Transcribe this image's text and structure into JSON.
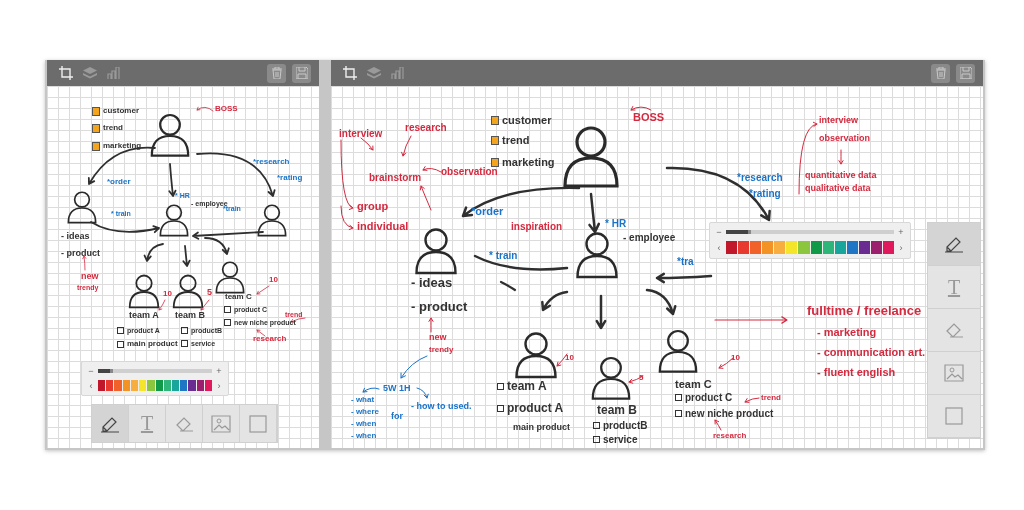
{
  "panels": [
    {
      "notes": [
        {
          "text": "customer",
          "color": "#333333",
          "kind": "tag"
        },
        {
          "text": "trend",
          "color": "#333333",
          "kind": "tag"
        },
        {
          "text": "marketing",
          "color": "#333333",
          "kind": "tag"
        },
        {
          "text": "BOSS",
          "color": "#d42a3f",
          "kind": "plain"
        },
        {
          "text": "*order",
          "color": "#1a73c8",
          "kind": "plain"
        },
        {
          "text": "*research",
          "color": "#1a73c8",
          "kind": "plain"
        },
        {
          "text": "*rating",
          "color": "#1a73c8",
          "kind": "plain"
        },
        {
          "text": "* HR",
          "color": "#1a73c8",
          "kind": "plain"
        },
        {
          "text": "- employee",
          "color": "#333333",
          "kind": "plain"
        },
        {
          "text": "* train",
          "color": "#1a73c8",
          "kind": "plain"
        },
        {
          "text": "*train",
          "color": "#1a73c8",
          "kind": "plain"
        },
        {
          "text": "- ideas",
          "color": "#333333",
          "kind": "plain"
        },
        {
          "text": "- product",
          "color": "#333333",
          "kind": "plain"
        },
        {
          "text": "new",
          "color": "#d42a3f",
          "kind": "plain"
        },
        {
          "text": "trendy",
          "color": "#d42a3f",
          "kind": "plain"
        },
        {
          "text": "10",
          "color": "#d42a3f",
          "kind": "plain"
        },
        {
          "text": "5",
          "color": "#d42a3f",
          "kind": "plain"
        },
        {
          "text": "10",
          "color": "#d42a3f",
          "kind": "plain"
        },
        {
          "text": "team A",
          "color": "#333333",
          "kind": "plain"
        },
        {
          "text": "team B",
          "color": "#333333",
          "kind": "plain"
        },
        {
          "text": "team C",
          "color": "#333333",
          "kind": "plain"
        },
        {
          "text": "product A",
          "color": "#333333",
          "kind": "checkbox"
        },
        {
          "text": "main product",
          "color": "#333333",
          "kind": "checkbox"
        },
        {
          "text": "productB",
          "color": "#333333",
          "kind": "checkbox"
        },
        {
          "text": "service",
          "color": "#333333",
          "kind": "checkbox"
        },
        {
          "text": "product C",
          "color": "#333333",
          "kind": "checkbox"
        },
        {
          "text": "new niche product",
          "color": "#333333",
          "kind": "checkbox"
        },
        {
          "text": "trend",
          "color": "#d42a3f",
          "kind": "plain"
        },
        {
          "text": "research",
          "color": "#d42a3f",
          "kind": "plain"
        }
      ],
      "palette": {
        "minus": "−",
        "plus": "+",
        "prev": "‹",
        "next": "›",
        "level": 0.13,
        "swatches": [
          {
            "color": "#c0182a"
          },
          {
            "color": "#e8392f"
          },
          {
            "color": "#f0622a"
          },
          {
            "color": "#f39325"
          },
          {
            "color": "#f8ae3f"
          },
          {
            "color": "#f5e52a"
          },
          {
            "color": "#8cc63f"
          },
          {
            "color": "#109a48"
          },
          {
            "color": "#2eb57a"
          },
          {
            "color": "#17a59c"
          },
          {
            "color": "#1f76c4"
          },
          {
            "color": "#6b2c91"
          },
          {
            "color": "#9c1f6e"
          },
          {
            "color": "#e0185c"
          }
        ]
      },
      "tools": {
        "items": [
          {
            "kind": "pen",
            "selected": true
          },
          {
            "kind": "text",
            "label": "T",
            "selected": false
          },
          {
            "kind": "eraser",
            "selected": false
          },
          {
            "kind": "image",
            "selected": false
          },
          {
            "kind": "shape",
            "selected": false
          }
        ]
      }
    },
    {
      "notes": [
        {
          "text": "interview",
          "color": "#d42a3f",
          "kind": "plain"
        },
        {
          "text": "research",
          "color": "#d42a3f",
          "kind": "plain"
        },
        {
          "text": "customer",
          "color": "#333333",
          "kind": "tag"
        },
        {
          "text": "trend",
          "color": "#333333",
          "kind": "tag"
        },
        {
          "text": "marketing",
          "color": "#333333",
          "kind": "tag"
        },
        {
          "text": "BOSS",
          "color": "#d42a3f",
          "kind": "plain"
        },
        {
          "text": "brainstorm",
          "color": "#d42a3f",
          "kind": "plain"
        },
        {
          "text": "observation",
          "color": "#d42a3f",
          "kind": "plain"
        },
        {
          "text": "group",
          "color": "#d42a3f",
          "kind": "plain"
        },
        {
          "text": "individual",
          "color": "#d42a3f",
          "kind": "plain"
        },
        {
          "text": "*order",
          "color": "#1a73c8",
          "kind": "plain"
        },
        {
          "text": "inspiration",
          "color": "#d42a3f",
          "kind": "plain"
        },
        {
          "text": "* HR",
          "color": "#1a73c8",
          "kind": "plain"
        },
        {
          "text": "- employee",
          "color": "#333333",
          "kind": "plain"
        },
        {
          "text": "interview",
          "color": "#d42a3f",
          "kind": "plain"
        },
        {
          "text": "observation",
          "color": "#d42a3f",
          "kind": "plain"
        },
        {
          "text": "quantitative data",
          "color": "#d42a3f",
          "kind": "plain"
        },
        {
          "text": "qualitative data",
          "color": "#d42a3f",
          "kind": "plain"
        },
        {
          "text": "*research",
          "color": "#1a73c8",
          "kind": "plain"
        },
        {
          "text": "*rating",
          "color": "#1a73c8",
          "kind": "plain"
        },
        {
          "text": "* train",
          "color": "#1a73c8",
          "kind": "plain"
        },
        {
          "text": "*tra",
          "color": "#1a73c8",
          "kind": "plain"
        },
        {
          "text": "- ideas",
          "color": "#333333",
          "kind": "plain"
        },
        {
          "text": "- product",
          "color": "#333333",
          "kind": "plain"
        },
        {
          "text": "new",
          "color": "#d42a3f",
          "kind": "plain"
        },
        {
          "text": "trendy",
          "color": "#d42a3f",
          "kind": "plain"
        },
        {
          "text": "fulltime / freelance",
          "color": "#d42a3f",
          "kind": "plain"
        },
        {
          "text": "- marketing",
          "color": "#d42a3f",
          "kind": "plain"
        },
        {
          "text": "- communication art.",
          "color": "#d42a3f",
          "kind": "plain"
        },
        {
          "text": "- fluent english",
          "color": "#d42a3f",
          "kind": "plain"
        },
        {
          "text": "5W 1H",
          "color": "#1a73c8",
          "kind": "plain"
        },
        {
          "text": "- what",
          "color": "#1a73c8",
          "kind": "plain"
        },
        {
          "text": "- where",
          "color": "#1a73c8",
          "kind": "plain"
        },
        {
          "text": "- when",
          "color": "#1a73c8",
          "kind": "plain"
        },
        {
          "text": "- when",
          "color": "#1a73c8",
          "kind": "plain"
        },
        {
          "text": "for",
          "color": "#1a73c8",
          "kind": "plain"
        },
        {
          "text": "- how to used.",
          "color": "#1a73c8",
          "kind": "plain"
        },
        {
          "text": "10",
          "color": "#d42a3f",
          "kind": "plain"
        },
        {
          "text": "team A",
          "color": "#333333",
          "kind": "checkbox"
        },
        {
          "text": "product A",
          "color": "#333333",
          "kind": "checkbox"
        },
        {
          "text": "main product",
          "color": "#333333",
          "kind": "plain"
        },
        {
          "text": "5",
          "color": "#d42a3f",
          "kind": "plain"
        },
        {
          "text": "team B",
          "color": "#333333",
          "kind": "plain"
        },
        {
          "text": "productB",
          "color": "#333333",
          "kind": "checkbox"
        },
        {
          "text": "service",
          "color": "#333333",
          "kind": "checkbox"
        },
        {
          "text": "10",
          "color": "#d42a3f",
          "kind": "plain"
        },
        {
          "text": "team C",
          "color": "#333333",
          "kind": "plain"
        },
        {
          "text": "product C",
          "color": "#333333",
          "kind": "checkbox"
        },
        {
          "text": "new niche product",
          "color": "#333333",
          "kind": "checkbox"
        },
        {
          "text": "trend",
          "color": "#d42a3f",
          "kind": "plain"
        },
        {
          "text": "research",
          "color": "#d42a3f",
          "kind": "plain"
        }
      ],
      "palette": {
        "minus": "−",
        "plus": "+",
        "prev": "‹",
        "next": "›",
        "level": 0.15,
        "swatches": [
          {
            "color": "#c0182a"
          },
          {
            "color": "#e8392f"
          },
          {
            "color": "#f0622a"
          },
          {
            "color": "#f39325"
          },
          {
            "color": "#f8ae3f"
          },
          {
            "color": "#f5e52a"
          },
          {
            "color": "#8cc63f"
          },
          {
            "color": "#109a48"
          },
          {
            "color": "#2eb57a"
          },
          {
            "color": "#17a59c"
          },
          {
            "color": "#1f76c4"
          },
          {
            "color": "#6b2c91"
          },
          {
            "color": "#9c1f6e"
          },
          {
            "color": "#e0185c"
          }
        ]
      },
      "tools": {
        "items": [
          {
            "kind": "pen",
            "selected": true
          },
          {
            "kind": "text",
            "label": "T",
            "selected": false
          },
          {
            "kind": "eraser",
            "selected": false
          },
          {
            "kind": "image",
            "selected": false
          },
          {
            "kind": "shape",
            "selected": false
          }
        ]
      }
    }
  ]
}
